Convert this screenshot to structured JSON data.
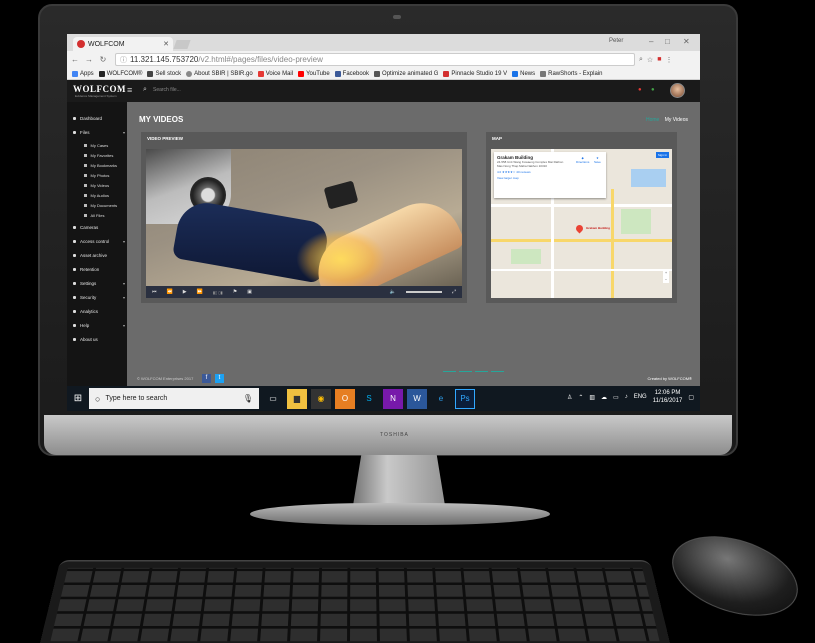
{
  "browser": {
    "tab_title": "WOLFCOM",
    "user": "Peter",
    "url_host": "11.321.145.753720",
    "url_path": "/v2.html#/pages/files/video-preview",
    "bookmarks": [
      {
        "label": "Apps",
        "color": "#4285f4"
      },
      {
        "label": "WOLFCOM®",
        "color": "#222222"
      },
      {
        "label": "Sell stock",
        "color": "#444444"
      },
      {
        "label": "About SBIR | SBIR.go",
        "color": "#888888"
      },
      {
        "label": "Voice Mail",
        "color": "#e53935"
      },
      {
        "label": "YouTube",
        "color": "#ff0000"
      },
      {
        "label": "Facebook",
        "color": "#3b5998"
      },
      {
        "label": "Optimize animated G",
        "color": "#555555"
      },
      {
        "label": "Pinnacle Studio 19 V",
        "color": "#d32f2f"
      },
      {
        "label": "News",
        "color": "#1a73e8"
      },
      {
        "label": "RawShorts - Explain",
        "color": "#777777"
      }
    ]
  },
  "app": {
    "brand": "WOLFCOM",
    "brand_sub": "Evidence Management System",
    "search_placeholder": "Search file...",
    "sidebar": {
      "items": [
        {
          "label": "Dashboard"
        },
        {
          "label": "Files"
        },
        {
          "label": "Cameras"
        },
        {
          "label": "Access control"
        },
        {
          "label": "Asset archive"
        },
        {
          "label": "Retention"
        },
        {
          "label": "Settings"
        },
        {
          "label": "Security"
        },
        {
          "label": "Analytics"
        },
        {
          "label": "Help"
        },
        {
          "label": "About us"
        }
      ],
      "file_sub_items": [
        "My Cases",
        "My Favorites",
        "My Bookmarks",
        "My Photos",
        "My Videos",
        "My Audios",
        "My Documents",
        "All Files"
      ]
    },
    "page_title": "MY VIDEOS",
    "breadcrumb_home": "Home",
    "breadcrumb_current": "My Videos",
    "video_panel_title": "VIDEO PREVIEW",
    "map_panel_title": "MAP",
    "map": {
      "place": "Grakam Building",
      "address": "24-558 Unit Wang Kowaeng Complex Mai Rathon Mas Nong Thap Maha Nakhon 10310",
      "rating": "4.0 ★★★★☆ 40 reviews",
      "larger_map": "View larger map",
      "directions": "Directions",
      "save": "Save",
      "sign_in": "Sign in",
      "pin_label": "Grakam Building"
    },
    "footer_copyright": "© WOLFCOM Enterprises 2017",
    "footer_created": "Created by WOLFCOM®"
  },
  "taskbar": {
    "search_placeholder": "Type here to search",
    "language": "ENG",
    "time": "12:06 PM",
    "date": "11/16/2017"
  },
  "monitor": {
    "brand": "TOSHIBA"
  }
}
